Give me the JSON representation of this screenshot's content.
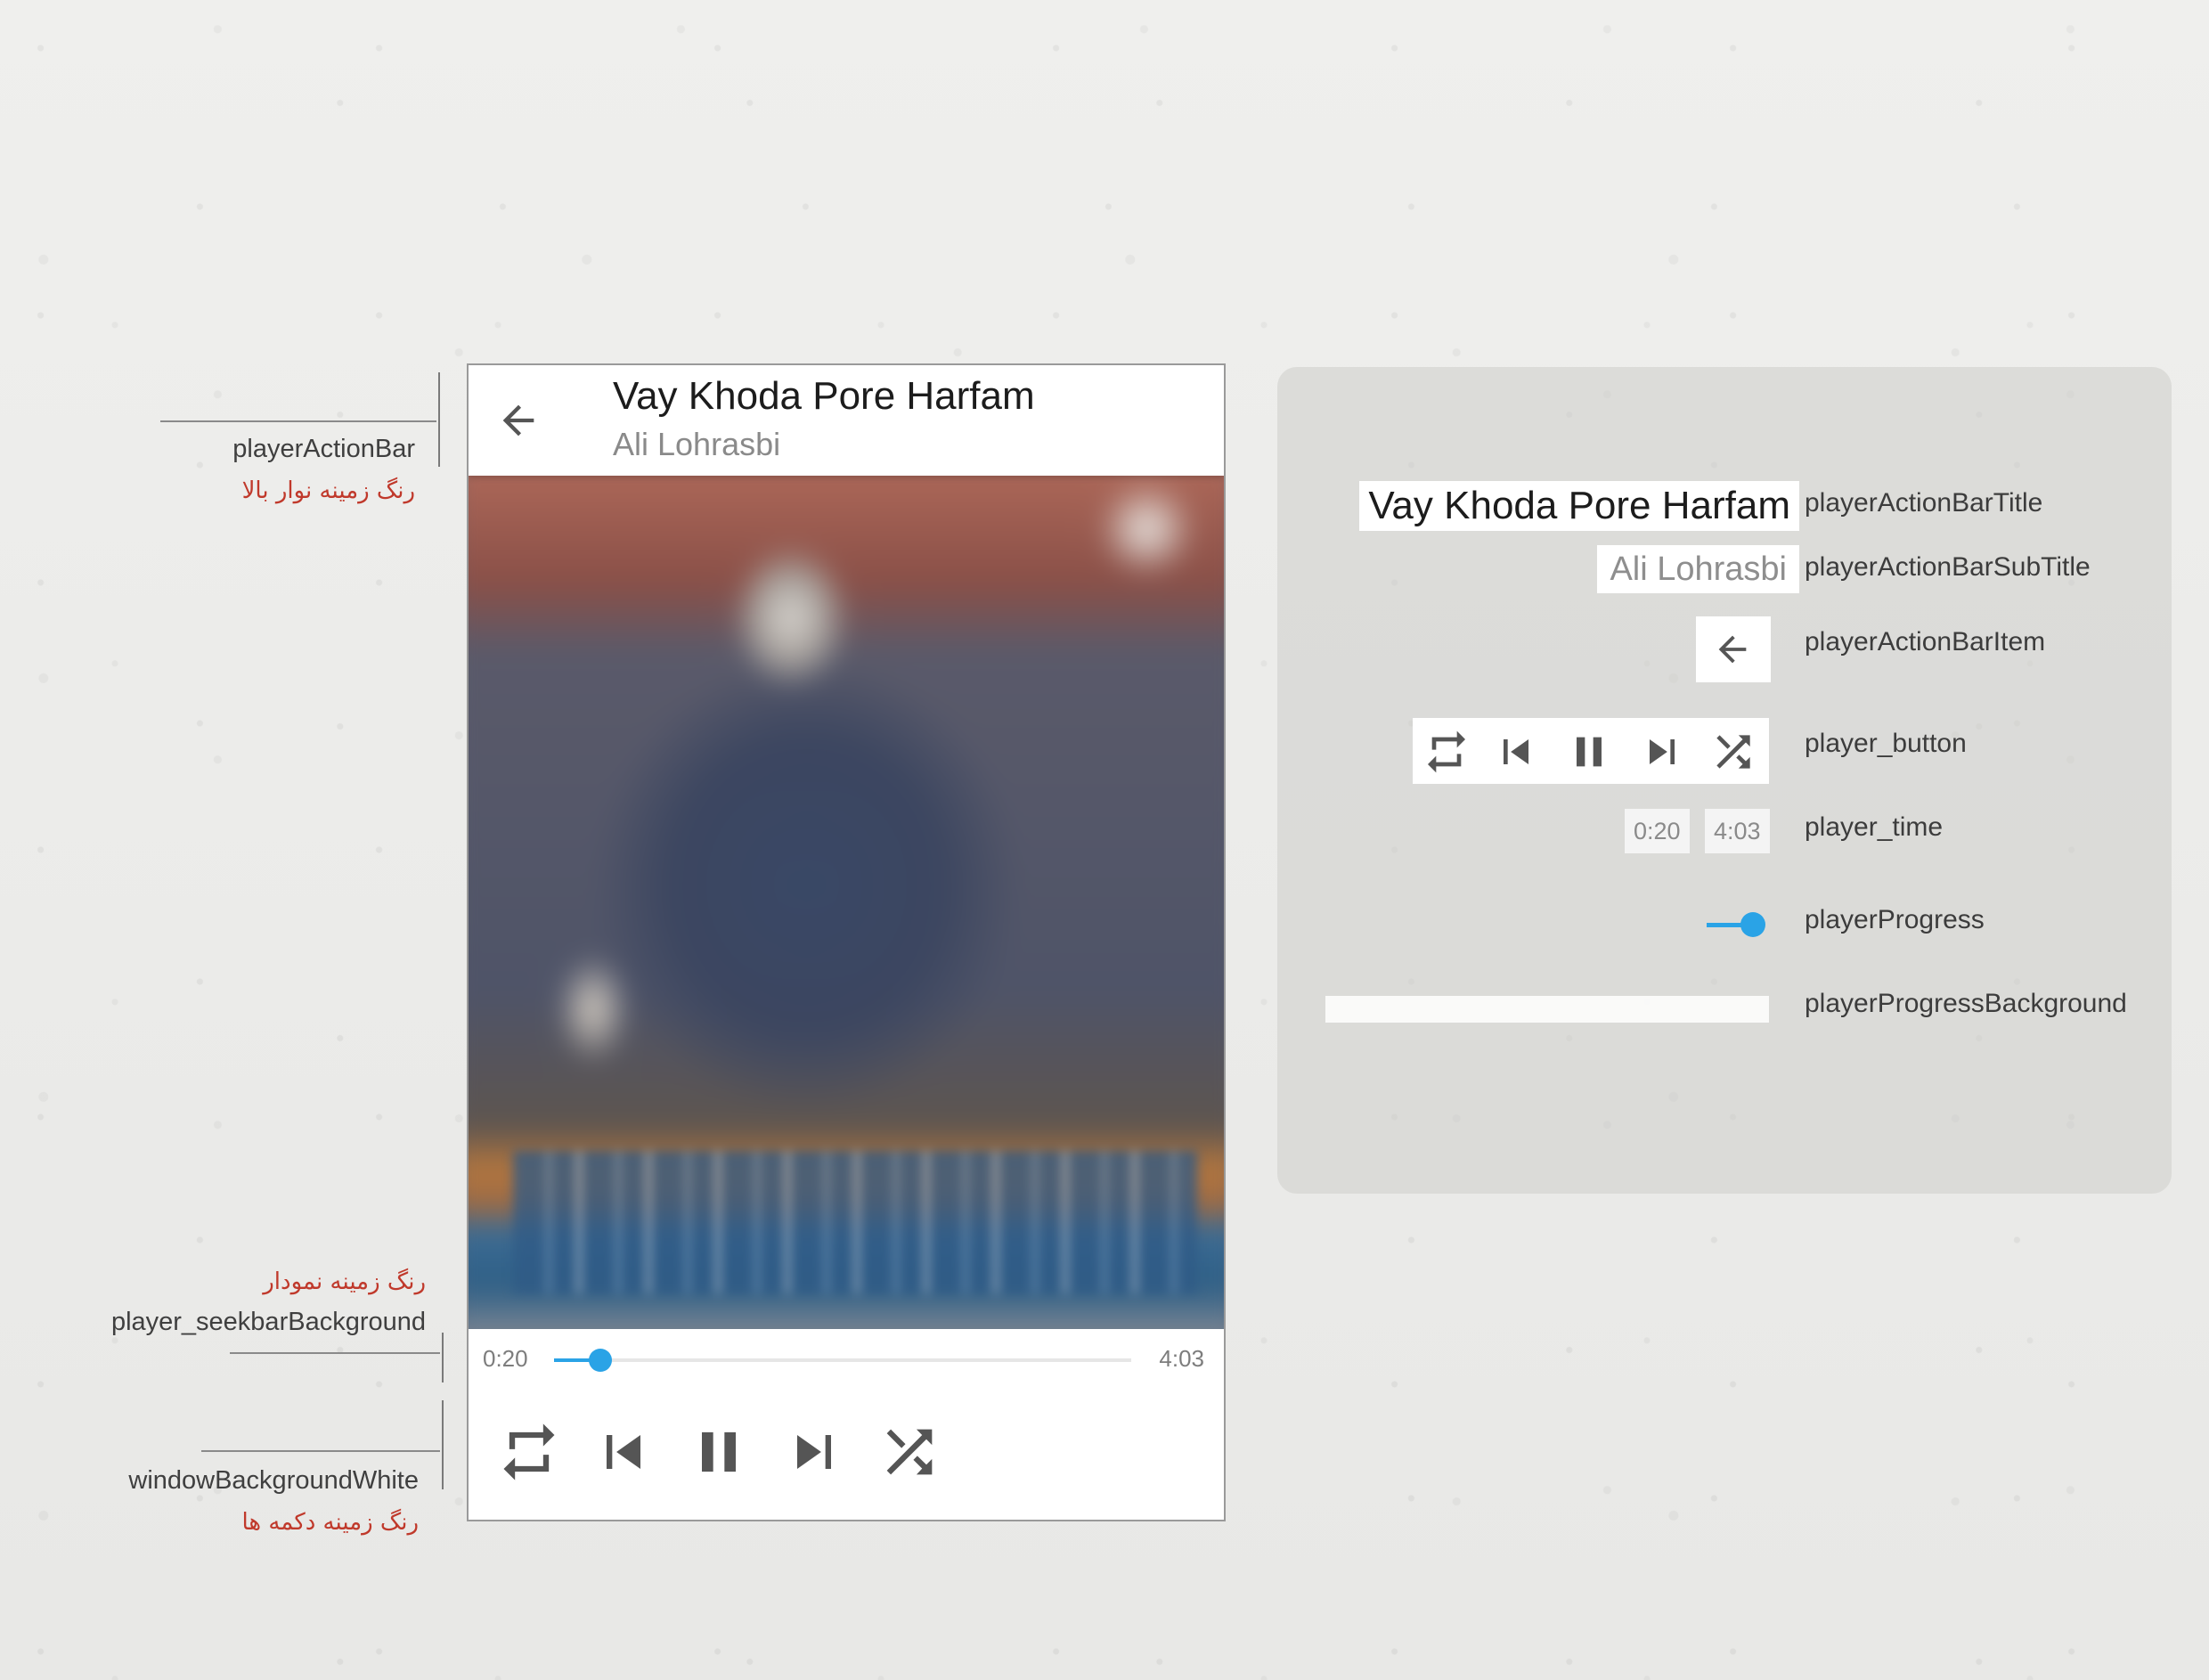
{
  "annotations": {
    "action_bar": {
      "name": "playerActionBar",
      "note_fa": "رنگ زمینه نوار بالا"
    },
    "seekbar": {
      "name": "player_seekbarBackground",
      "note_fa": "رنگ زمینه نمودار"
    },
    "window": {
      "name": "windowBackgroundWhite",
      "note_fa": "رنگ زمینه دکمه ها"
    }
  },
  "player": {
    "title": "Vay Khoda Pore Harfam",
    "artist": "Ali Lohrasbi",
    "time_current": "0:20",
    "time_total": "4:03",
    "progress_fraction": 0.08,
    "controls": {
      "repeat": "repeat-icon",
      "previous": "skip-previous-icon",
      "pause": "pause-icon",
      "next": "skip-next-icon",
      "shuffle": "shuffle-icon"
    }
  },
  "legend": {
    "title_sample": "Vay Khoda Pore Harfam",
    "subtitle_sample": "Ali Lohrasbi",
    "time_current": "0:20",
    "time_total": "4:03",
    "labels": {
      "title": "playerActionBarTitle",
      "subtitle": "playerActionBarSubTitle",
      "item": "playerActionBarItem",
      "button": "player_button",
      "time": "player_time",
      "progress": "playerProgress",
      "progress_bg": "playerProgressBackground"
    }
  },
  "colors": {
    "accent": "#2aa3e6",
    "annotation_fa": "#c0392b"
  }
}
